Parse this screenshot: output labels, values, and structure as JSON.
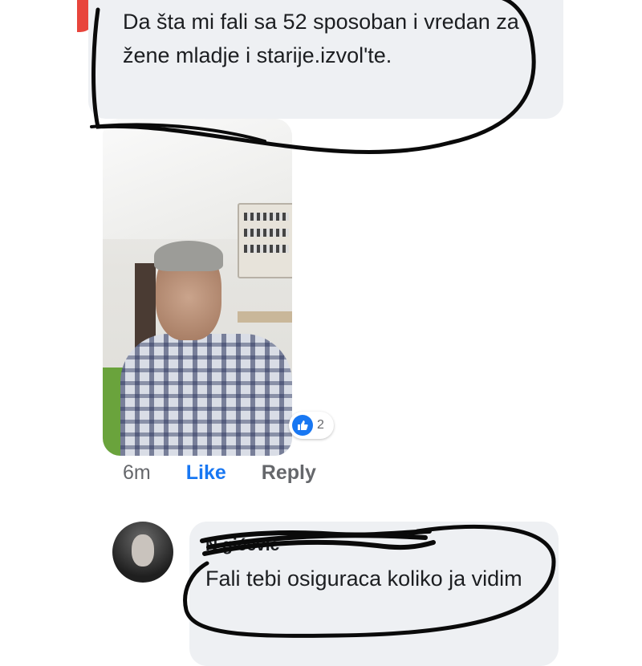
{
  "comment_top": {
    "text": "Da šta mi fali sa 52 sposoban i vredan za žene mladje i starije.izvol'te.",
    "reaction_count": "2",
    "reaction_icon": "like-icon"
  },
  "actions": {
    "time": "6m",
    "like_label": "Like",
    "reply_label": "Reply"
  },
  "comment_bottom": {
    "author": "N         gićević",
    "text": "Fali tebi osiguraca koliko ja vidim"
  },
  "colors": {
    "link_blue": "#1877f2",
    "bubble_gray": "#eef0f3",
    "meta_gray": "#65676b",
    "annotation_black": "#000000"
  }
}
